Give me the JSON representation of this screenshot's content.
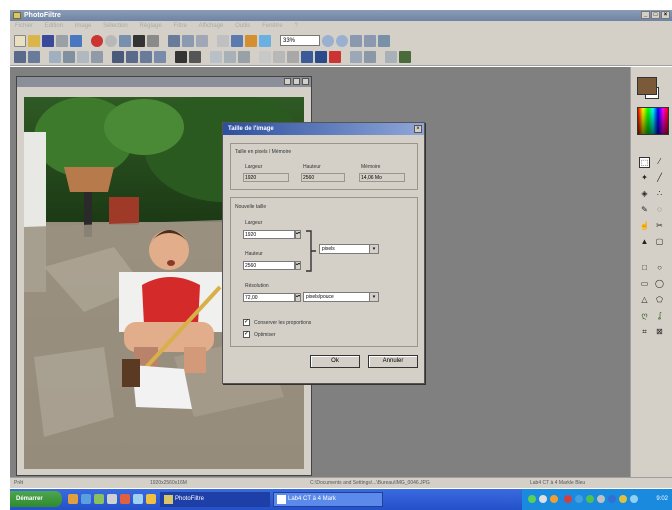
{
  "window": {
    "title": "PhotoFiltre"
  },
  "menu": {
    "items": [
      "Fichier",
      "Edition",
      "Image",
      "Sélection",
      "Réglage",
      "Filtre",
      "Affichage",
      "Outils",
      "Fenêtre",
      "?"
    ]
  },
  "toolbar": {
    "zoom": "33%"
  },
  "dialog": {
    "title": "Taille de l'image",
    "current_group_label": "Taille en pixels / Mémoire",
    "current": {
      "width_label": "Largeur",
      "width_value": "1920",
      "height_label": "Hauteur",
      "height_value": "2560",
      "memory_label": "Mémoire",
      "memory_value": "14,06 Mo"
    },
    "new_group_label": "Nouvelle taille",
    "new": {
      "width_label": "Largeur",
      "width_value": "1920",
      "height_label": "Hauteur",
      "height_value": "2560",
      "unit_value": "pixels",
      "resolution_label": "Résolution",
      "resolution_value": "72,00",
      "resolution_unit_value": "pixels/pouce"
    },
    "checkbox_proportions": "Conserver les proportions",
    "checkbox_optimize": "Optimiser",
    "ok_label": "Ok",
    "cancel_label": "Annuler"
  },
  "statusbar": {
    "state": "Prêt",
    "dimensions": "1920x2560x16M",
    "path": "C:\\Documents and Settings\\...\\Bureau\\IMG_0046.JPG",
    "info": "Lab4 CT à 4 Markle Bleu"
  },
  "taskbar": {
    "start_label": "Démarrer",
    "task_photofiltre": "PhotoFiltre",
    "task_other": "Lab4 CT à 4 Mark",
    "clock": "9:02"
  },
  "colors": {
    "foreground_swatch": "#7b5a3a",
    "background_swatch": "#ffffff",
    "workspace": "#808080",
    "dialog_title": "#2c4f9e"
  }
}
